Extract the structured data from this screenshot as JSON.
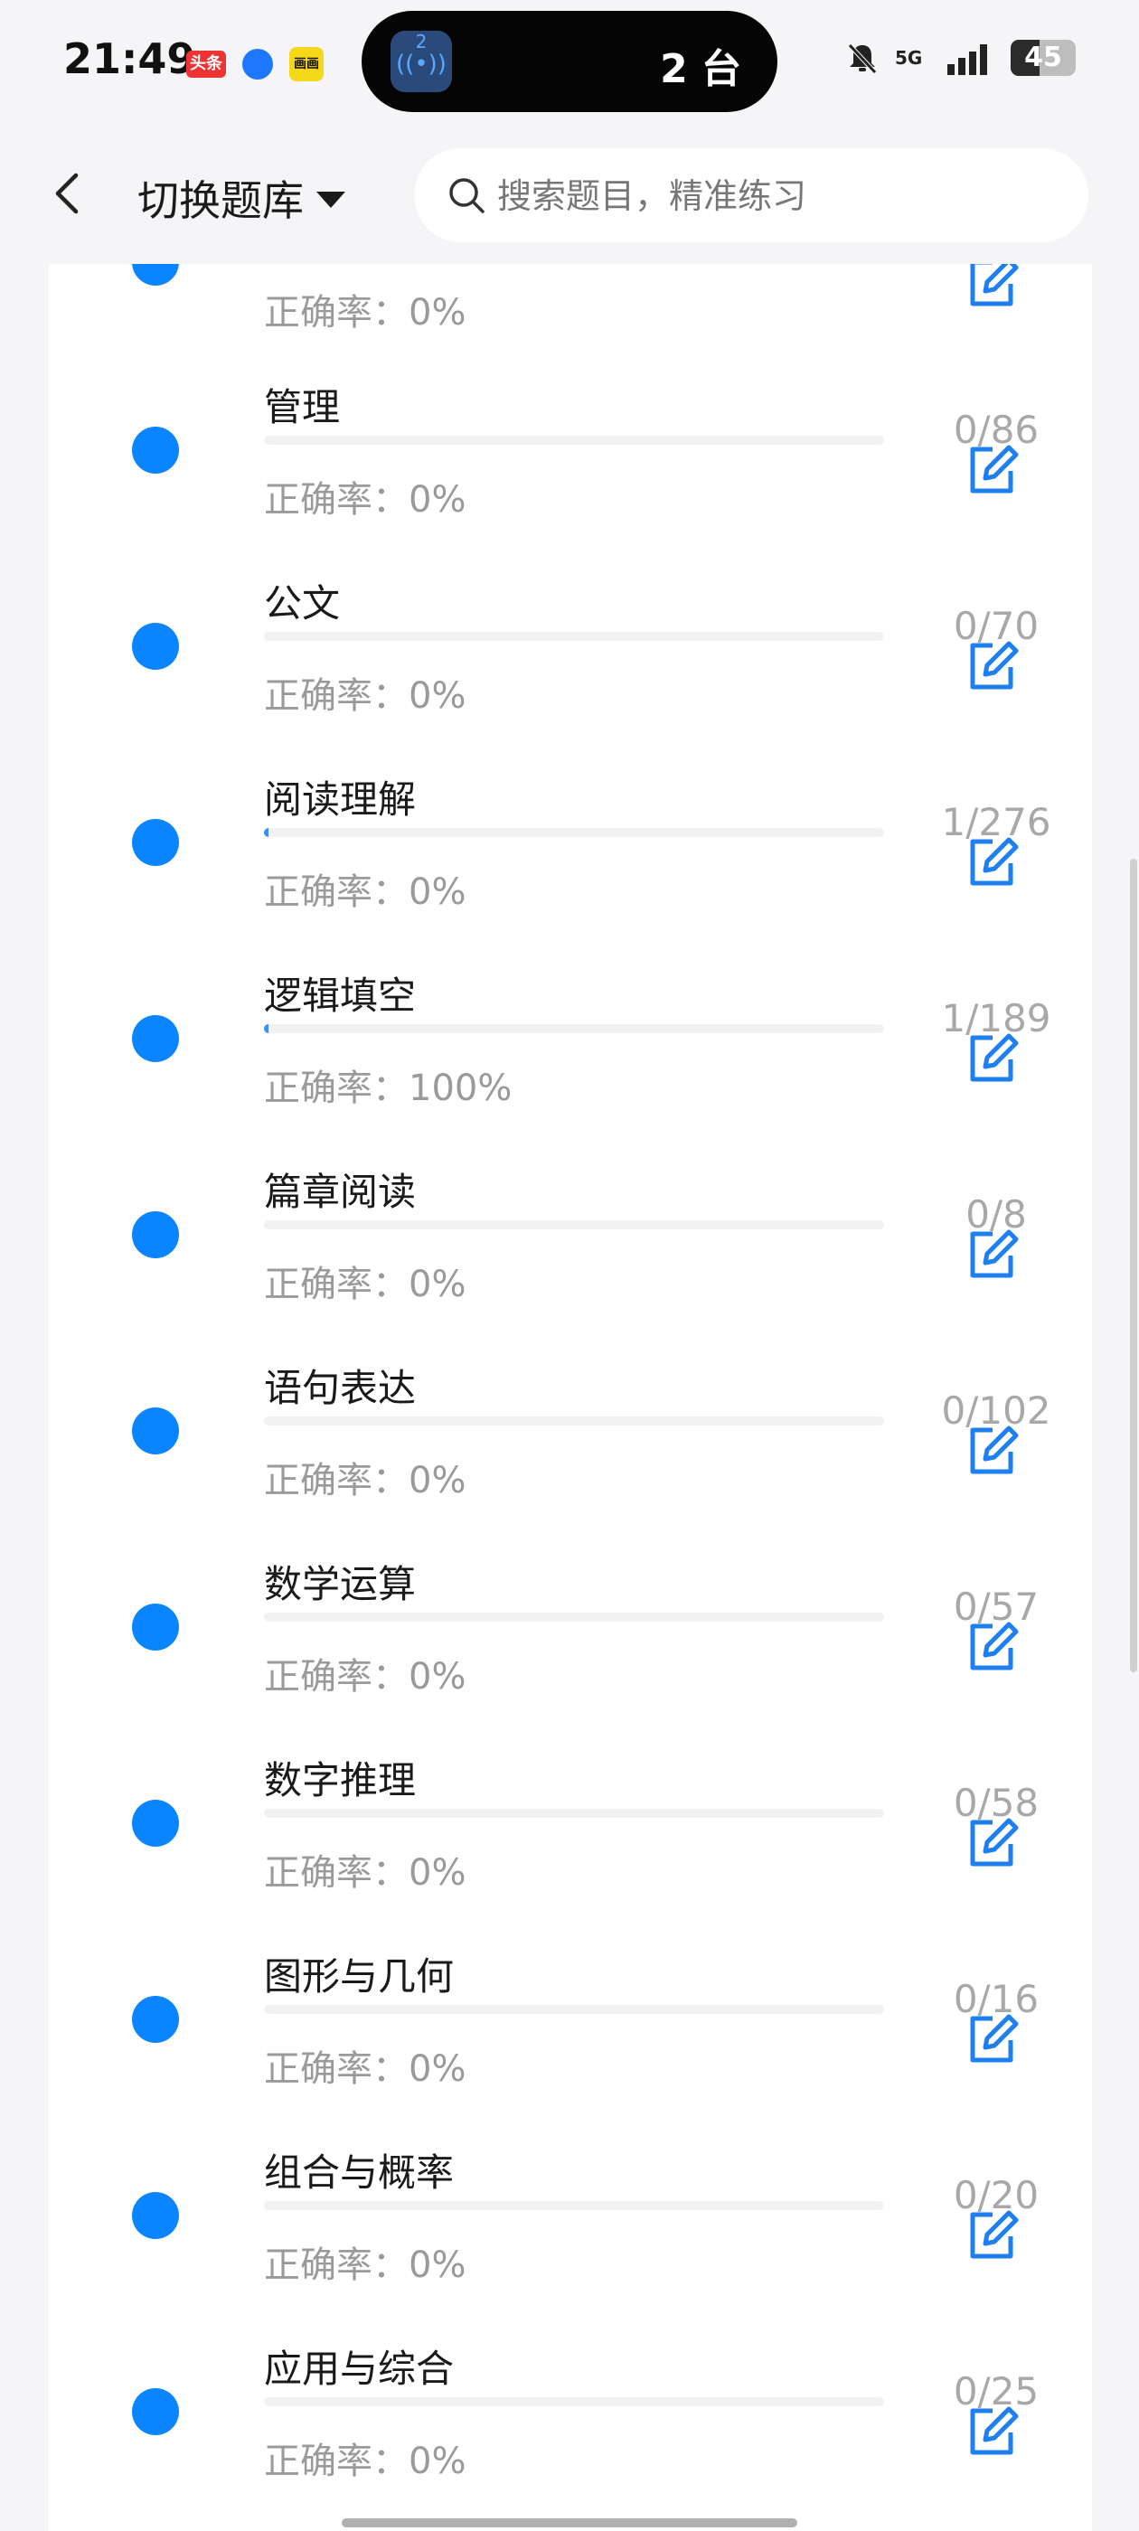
{
  "status_bar": {
    "time": "21:49",
    "app_badges": [
      "头条",
      "e",
      "画画"
    ],
    "island_text": "2 台",
    "island_badge": "2",
    "network": "5G",
    "battery": "45"
  },
  "header": {
    "title": "切换题库",
    "search_placeholder": "搜索题目，精准练习"
  },
  "accuracy_prefix": "正确率：",
  "rows": [
    {
      "name": "",
      "accuracy": "0%",
      "count": "",
      "progress": 0
    },
    {
      "name": "管理",
      "accuracy": "0%",
      "count": "0/86",
      "progress": 0
    },
    {
      "name": "公文",
      "accuracy": "0%",
      "count": "0/70",
      "progress": 0
    },
    {
      "name": "阅读理解",
      "accuracy": "0%",
      "count": "1/276",
      "progress": 0.0036
    },
    {
      "name": "逻辑填空",
      "accuracy": "100%",
      "count": "1/189",
      "progress": 0.0053
    },
    {
      "name": "篇章阅读",
      "accuracy": "0%",
      "count": "0/8",
      "progress": 0
    },
    {
      "name": "语句表达",
      "accuracy": "0%",
      "count": "0/102",
      "progress": 0
    },
    {
      "name": "数学运算",
      "accuracy": "0%",
      "count": "0/57",
      "progress": 0
    },
    {
      "name": "数字推理",
      "accuracy": "0%",
      "count": "0/58",
      "progress": 0
    },
    {
      "name": "图形与几何",
      "accuracy": "0%",
      "count": "0/16",
      "progress": 0
    },
    {
      "name": "组合与概率",
      "accuracy": "0%",
      "count": "0/20",
      "progress": 0
    },
    {
      "name": "应用与综合",
      "accuracy": "0%",
      "count": "0/25",
      "progress": 0
    }
  ]
}
